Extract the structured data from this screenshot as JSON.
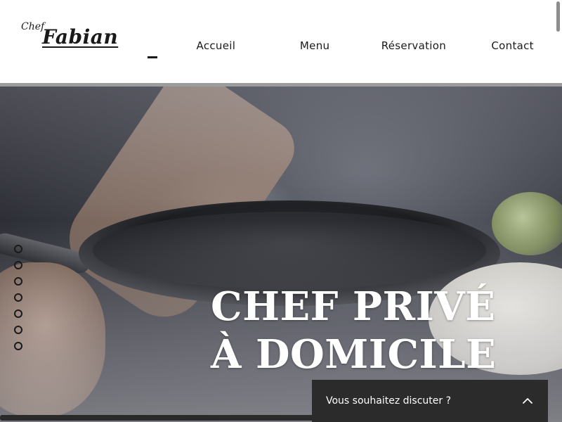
{
  "logo": {
    "small": "Chef",
    "big": "Fabian"
  },
  "nav": {
    "items": [
      "Accueil",
      "Menu",
      "Réservation",
      "Contact"
    ]
  },
  "hero": {
    "title_line1": "CHEF PRIVÉ",
    "title_line2": "À DOMICILE",
    "slide_count": 7
  },
  "chat": {
    "label": "Vous souhaitez discuter ?",
    "icon": "chevron-up-icon"
  },
  "colors": {
    "header_bg": "#ffffff",
    "text": "#1a1a1a",
    "chat_bg": "#2b2b2b",
    "hero_text": "#ffffff"
  }
}
